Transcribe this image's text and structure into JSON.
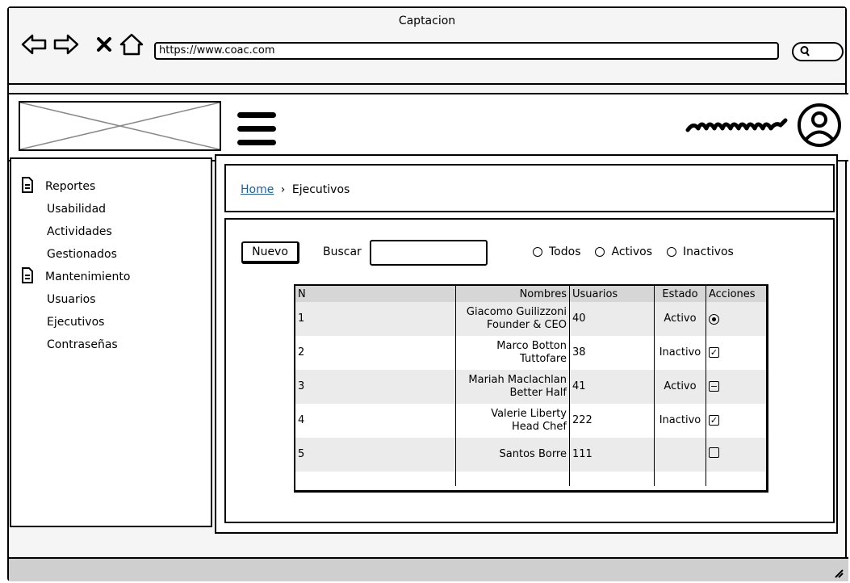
{
  "window": {
    "title": "Captacion"
  },
  "browser": {
    "url": "https://www.coac.com",
    "search_icon": "search-icon",
    "nav_icons": [
      "back-arrow-icon",
      "forward-arrow-icon",
      "close-x-icon",
      "home-icon"
    ]
  },
  "header": {
    "logo_icon": "image-placeholder-icon",
    "menu_icon": "hamburger-menu-icon",
    "username_icon": "scribbled-username-icon",
    "avatar_icon": "user-avatar-icon"
  },
  "sidebar": {
    "groups": [
      {
        "icon": "document-icon",
        "label": "Reportes",
        "items": [
          "Usabilidad",
          "Actividades",
          "Gestionados"
        ]
      },
      {
        "icon": "document-icon",
        "label": "Mantenimiento",
        "items": [
          "Usuarios",
          "Ejecutivos",
          "Contraseñas"
        ]
      }
    ]
  },
  "breadcrumb": {
    "home": "Home",
    "separator": "›",
    "current": "Ejecutivos"
  },
  "toolbar": {
    "nuevo_label": "Nuevo",
    "buscar_label": "Buscar",
    "search_value": "",
    "filters": [
      "Todos",
      "Activos",
      "Inactivos"
    ]
  },
  "table": {
    "headers": [
      "N",
      "Nombres",
      "Usuarios",
      "Estado",
      "Acciones"
    ],
    "rows": [
      {
        "n": "1",
        "name": "Giacomo Guilizzoni",
        "role": "Founder & CEO",
        "usuarios": "40",
        "estado": "Activo",
        "accion": "radio-selected"
      },
      {
        "n": "2",
        "name": "Marco Botton",
        "role": "Tuttofare",
        "usuarios": "38",
        "estado": "Inactivo",
        "accion": "checkbox-checked"
      },
      {
        "n": "3",
        "name": "Mariah Maclachlan",
        "role": "Better Half",
        "usuarios": "41",
        "estado": "Activo",
        "accion": "checkbox-indeterminate"
      },
      {
        "n": "4",
        "name": "Valerie Liberty",
        "role": "Head Chef",
        "usuarios": "222",
        "estado": "Inactivo",
        "accion": "checkbox-checked"
      },
      {
        "n": "5",
        "name": "Santos Borre",
        "role": "",
        "usuarios": "111",
        "estado": "",
        "accion": "checkbox-empty"
      }
    ]
  },
  "colors": {
    "link": "#1a5fb4",
    "row_alt": "#ebebeb",
    "header_bg": "#d6d6d6",
    "status_bar": "#cfcfcf"
  }
}
